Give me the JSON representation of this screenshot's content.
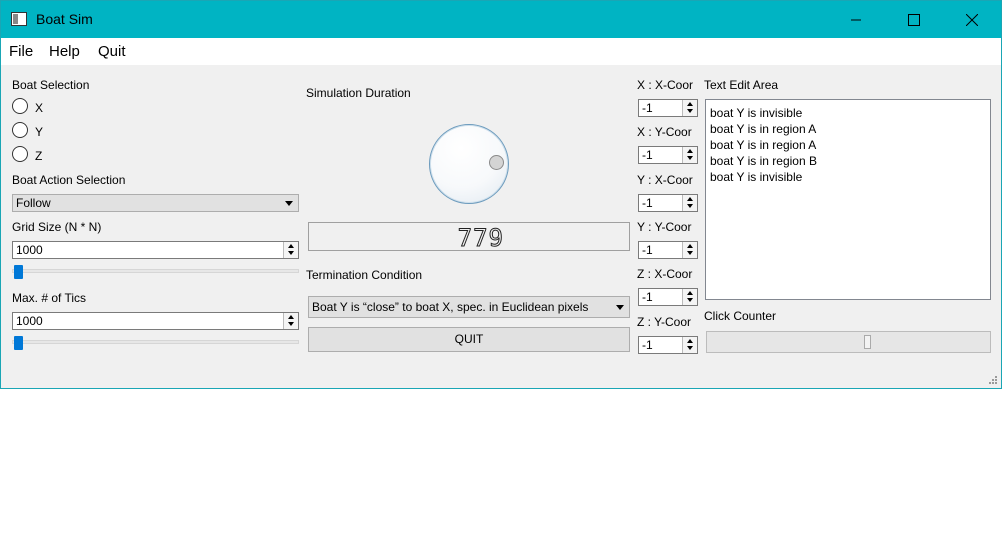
{
  "window": {
    "title": "Boat Sim"
  },
  "menu": {
    "items": [
      "File",
      "Help",
      "Quit"
    ]
  },
  "boat_selection": {
    "label": "Boat Selection",
    "options": [
      "X",
      "Y",
      "Z"
    ]
  },
  "boat_action": {
    "label": "Boat Action Selection",
    "selected": "Follow"
  },
  "grid_size": {
    "label": "Grid Size (N * N)",
    "value": "1000",
    "slider_fraction": 0.0
  },
  "max_tics": {
    "label": "Max. # of Tics",
    "value": "1000",
    "slider_fraction": 0.0
  },
  "simulation": {
    "label": "Simulation Duration",
    "lcd_value": "779"
  },
  "termination": {
    "label": "Termination Condition",
    "selected": "Boat Y is “close” to boat X, spec. in Euclidean pixels"
  },
  "quit_button": {
    "label": "QUIT"
  },
  "coords": [
    {
      "label": "X : X-Coor",
      "value": "-1"
    },
    {
      "label": "X : Y-Coor",
      "value": "-1"
    },
    {
      "label": "Y : X-Coor",
      "value": "-1"
    },
    {
      "label": "Y : Y-Coor",
      "value": "-1"
    },
    {
      "label": "Z : X-Coor",
      "value": "-1"
    },
    {
      "label": "Z : Y-Coor",
      "value": "-1"
    }
  ],
  "text_edit": {
    "label": "Text Edit Area",
    "lines": [
      "boat Y is invisible",
      "boat Y is in region A",
      "boat Y is in region A",
      "boat Y is in region B",
      "boat Y is invisible"
    ]
  },
  "click_counter": {
    "label": "Click Counter"
  },
  "colors": {
    "titlebar": "#00b4c3",
    "accent": "#0078d7"
  }
}
